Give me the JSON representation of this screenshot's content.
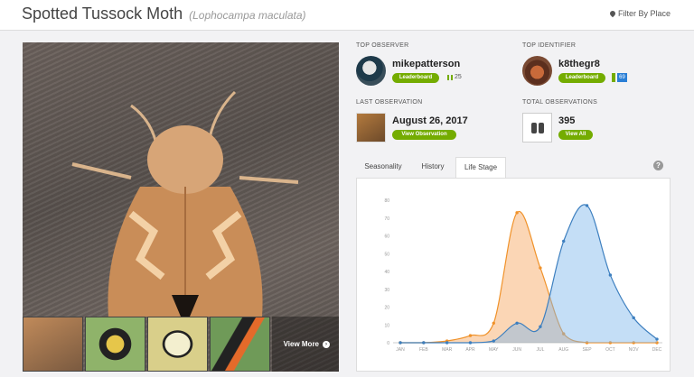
{
  "header": {
    "common_name": "Spotted Tussock Moth",
    "scientific_name": "(Lophocampa maculata)",
    "filter_label": "Filter By Place"
  },
  "photo": {
    "view_more_label": "View More"
  },
  "stats": {
    "top_observer": {
      "label": "TOP OBSERVER",
      "name": "mikepatterson",
      "button": "Leaderboard",
      "count": "25"
    },
    "top_identifier": {
      "label": "TOP IDENTIFIER",
      "name": "k8thegr8",
      "button": "Leaderboard",
      "badge": "69"
    },
    "last_observation": {
      "label": "LAST OBSERVATION",
      "date": "August 26, 2017",
      "button": "View Observation"
    },
    "total_observations": {
      "label": "TOTAL OBSERVATIONS",
      "count": "395",
      "button": "View All"
    }
  },
  "tabs": [
    "Seasonality",
    "History",
    "Life Stage"
  ],
  "active_tab": "Life Stage",
  "help_label": "?",
  "colors": {
    "green": "#74ac00",
    "orange": "#f7a35c",
    "blue": "#7cb5ec",
    "blue_line": "#3d7fbf",
    "orange_line": "#f0922a"
  },
  "chart_data": {
    "type": "area",
    "categories": [
      "JAN",
      "FEB",
      "MAR",
      "APR",
      "MAY",
      "JUN",
      "JUL",
      "AUG",
      "SEP",
      "OCT",
      "NOV",
      "DEC"
    ],
    "ylim": [
      0,
      80
    ],
    "yticks": [
      0,
      10,
      20,
      30,
      40,
      50,
      60,
      70,
      80
    ],
    "grid": false,
    "series": [
      {
        "color": "#f7a35c",
        "values": [
          0,
          0,
          1,
          4,
          11,
          73,
          42,
          5,
          0,
          0,
          0,
          0
        ]
      },
      {
        "color": "#7cb5ec",
        "values": [
          0,
          0,
          0,
          0,
          1,
          11,
          9,
          57,
          77,
          38,
          14,
          2
        ]
      }
    ]
  }
}
